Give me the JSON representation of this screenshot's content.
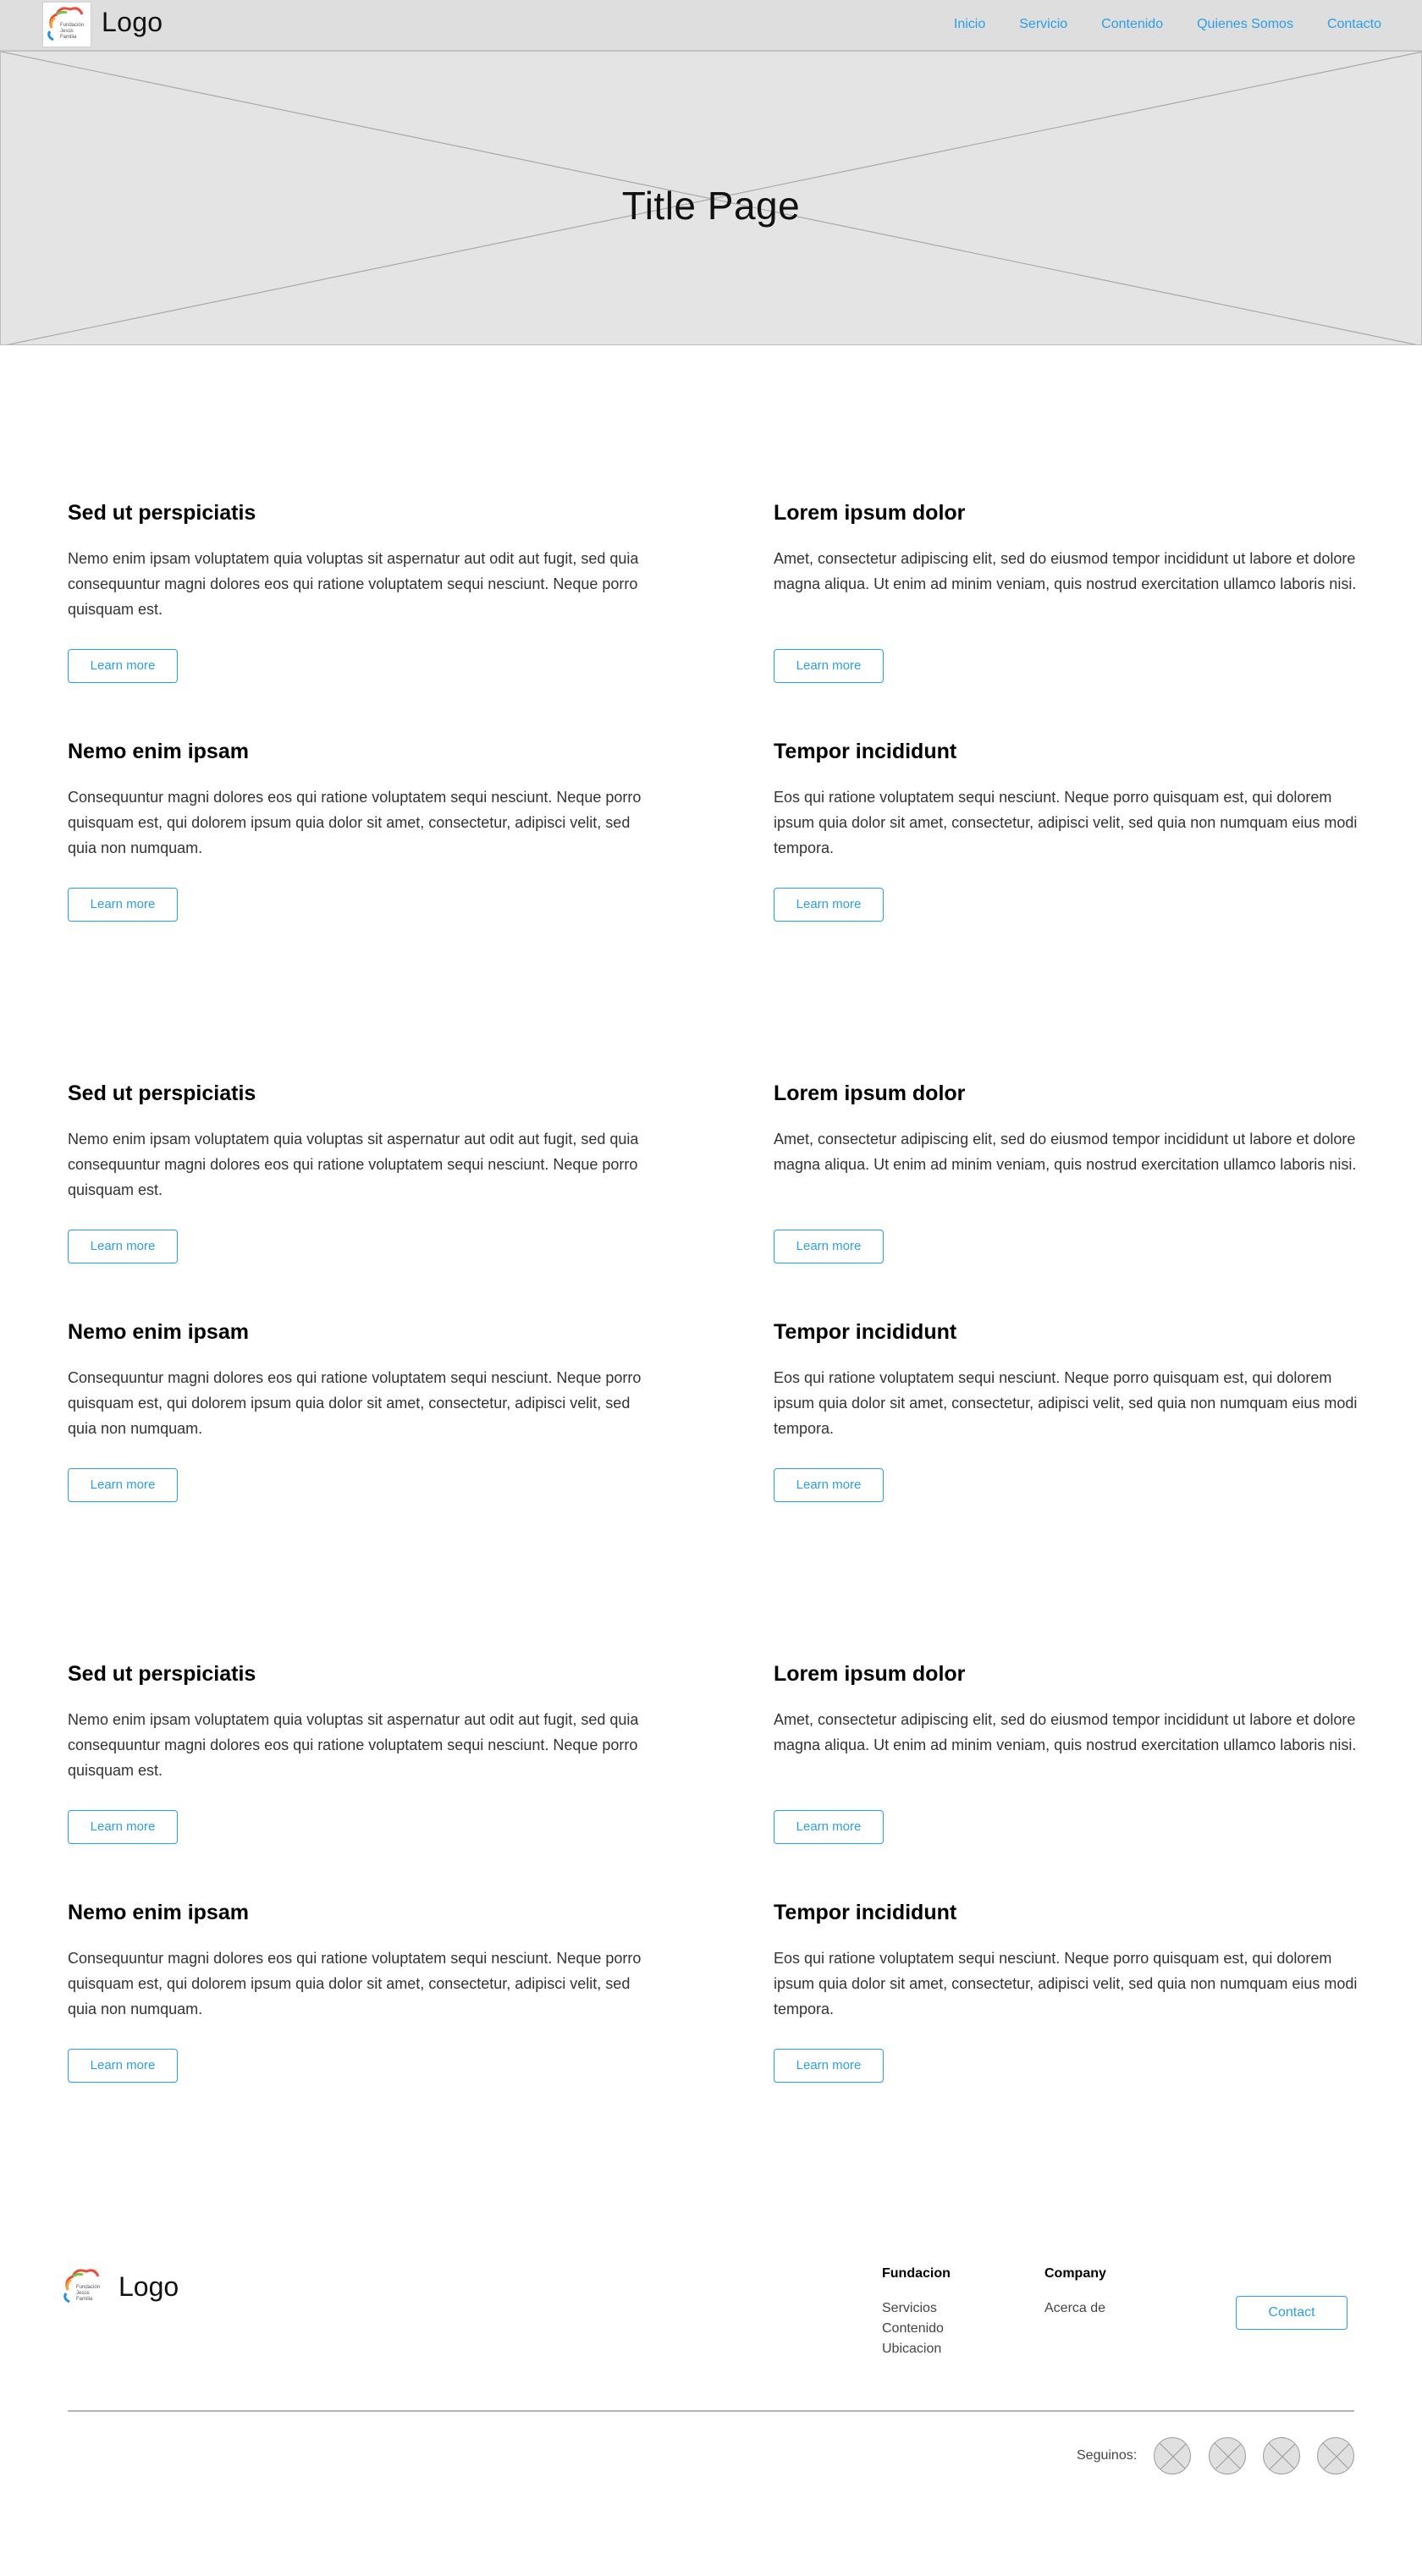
{
  "header": {
    "logo_text": "Logo",
    "logo_image_text": [
      "Fundación",
      "Jesús",
      "Familia"
    ],
    "nav": [
      "Inicio",
      "Servicio",
      "Contenido",
      "Quienes Somos",
      "Contacto"
    ]
  },
  "hero": {
    "title": "Title Page"
  },
  "sections": [
    {
      "cards": [
        {
          "title": "Sed ut perspiciatis",
          "body": "Nemo enim ipsam voluptatem quia voluptas sit aspernatur aut odit aut fugit, sed quia consequuntur magni dolores eos qui ratione voluptatem sequi nesciunt. Neque porro quisquam est.",
          "button": "Learn more"
        },
        {
          "title": "Lorem ipsum dolor",
          "body": "Amet, consectetur adipiscing elit, sed do eiusmod tempor incididunt ut labore et dolore magna aliqua. Ut enim ad minim veniam, quis nostrud exercitation ullamco laboris nisi.",
          "button": "Learn more"
        },
        {
          "title": "Nemo enim ipsam",
          "body": "Consequuntur magni dolores eos qui ratione voluptatem sequi nesciunt. Neque porro quisquam est, qui dolorem ipsum quia dolor sit amet, consectetur, adipisci velit, sed quia non numquam.",
          "button": "Learn more"
        },
        {
          "title": "Tempor incididunt",
          "body": "Eos qui ratione voluptatem sequi nesciunt. Neque porro quisquam est, qui dolorem ipsum quia dolor sit amet, consectetur, adipisci velit, sed quia non numquam eius modi tempora.",
          "button": "Learn more"
        }
      ]
    },
    {
      "cards": [
        {
          "title": "Sed ut perspiciatis",
          "body": "Nemo enim ipsam voluptatem quia voluptas sit aspernatur aut odit aut fugit, sed quia consequuntur magni dolores eos qui ratione voluptatem sequi nesciunt. Neque porro quisquam est.",
          "button": "Learn more"
        },
        {
          "title": "Lorem ipsum dolor",
          "body": "Amet, consectetur adipiscing elit, sed do eiusmod tempor incididunt ut labore et dolore magna aliqua. Ut enim ad minim veniam, quis nostrud exercitation ullamco laboris nisi.",
          "button": "Learn more"
        },
        {
          "title": "Nemo enim ipsam",
          "body": "Consequuntur magni dolores eos qui ratione voluptatem sequi nesciunt. Neque porro quisquam est, qui dolorem ipsum quia dolor sit amet, consectetur, adipisci velit, sed quia non numquam.",
          "button": "Learn more"
        },
        {
          "title": "Tempor incididunt",
          "body": "Eos qui ratione voluptatem sequi nesciunt. Neque porro quisquam est, qui dolorem ipsum quia dolor sit amet, consectetur, adipisci velit, sed quia non numquam eius modi tempora.",
          "button": "Learn more"
        }
      ]
    },
    {
      "cards": [
        {
          "title": "Sed ut perspiciatis",
          "body": "Nemo enim ipsam voluptatem quia voluptas sit aspernatur aut odit aut fugit, sed quia consequuntur magni dolores eos qui ratione voluptatem sequi nesciunt. Neque porro quisquam est.",
          "button": "Learn more"
        },
        {
          "title": "Lorem ipsum dolor",
          "body": "Amet, consectetur adipiscing elit, sed do eiusmod tempor incididunt ut labore et dolore magna aliqua. Ut enim ad minim veniam, quis nostrud exercitation ullamco laboris nisi.",
          "button": "Learn more"
        },
        {
          "title": "Nemo enim ipsam",
          "body": "Consequuntur magni dolores eos qui ratione voluptatem sequi nesciunt. Neque porro quisquam est, qui dolorem ipsum quia dolor sit amet, consectetur, adipisci velit, sed quia non numquam.",
          "button": "Learn more"
        },
        {
          "title": "Tempor incididunt",
          "body": "Eos qui ratione voluptatem sequi nesciunt. Neque porro quisquam est, qui dolorem ipsum quia dolor sit amet, consectetur, adipisci velit, sed quia non numquam eius modi tempora.",
          "button": "Learn more"
        }
      ]
    }
  ],
  "footer": {
    "logo_text": "Logo",
    "logo_image_text": [
      "Fundación",
      "Jesús",
      "Familia"
    ],
    "columns": [
      {
        "heading": "Fundacion",
        "links": [
          "Servicios",
          "Contenido",
          "Ubicacion"
        ]
      },
      {
        "heading": "Company",
        "links": [
          "Acerca de"
        ]
      }
    ],
    "contact_button": "Contact",
    "follow_label": "Seguinos:",
    "social_icons": [
      "social-placeholder-icon",
      "social-placeholder-icon",
      "social-placeholder-icon",
      "social-placeholder-icon"
    ]
  },
  "colors": {
    "accent": "#2a9fe6",
    "header_bg": "#dedede",
    "hero_bg": "#e4e4e4"
  }
}
